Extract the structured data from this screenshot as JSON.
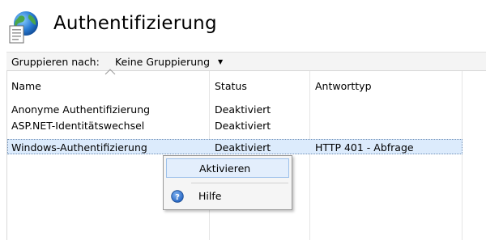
{
  "page": {
    "title": "Authentifizierung"
  },
  "toolbar": {
    "group_label": "Gruppieren nach:",
    "group_value": "Keine Gruppierung"
  },
  "table": {
    "columns": [
      "Name",
      "Status",
      "Antworttyp"
    ],
    "rows": [
      {
        "name": "Anonyme Authentifizierung",
        "status": "Deaktiviert",
        "response": ""
      },
      {
        "name": "ASP.NET-Identitätswechsel",
        "status": "Deaktiviert",
        "response": ""
      },
      {
        "name": "Windows-Authentifizierung",
        "status": "Deaktiviert",
        "response": "HTTP 401 - Abfrage"
      }
    ]
  },
  "context_menu": {
    "items": [
      {
        "label": "Aktivieren",
        "icon": ""
      },
      {
        "label": "Hilfe",
        "icon": "help-icon"
      }
    ]
  },
  "colors": {
    "selection": "#dcebfc",
    "menu_hover": "#e3eefc",
    "help_blue": "#1f5fbf"
  }
}
